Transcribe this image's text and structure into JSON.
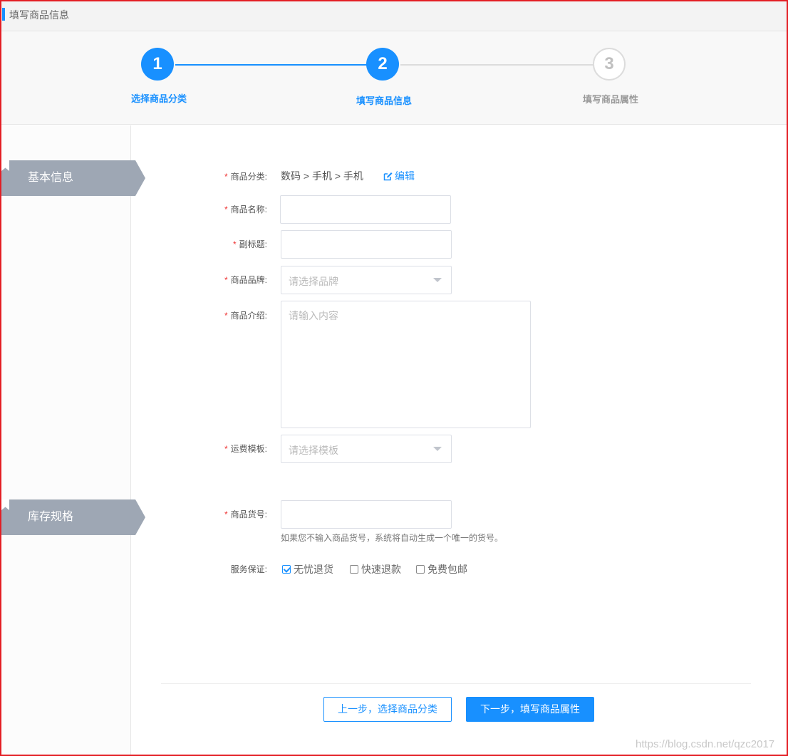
{
  "page": {
    "title": "填写商品信息"
  },
  "colors": {
    "accent": "#1890ff",
    "frame": "#e31e24",
    "required": "#e33333",
    "section_tag": "#9ea7b4"
  },
  "steps": [
    {
      "number": "1",
      "label": "选择商品分类",
      "state": "done"
    },
    {
      "number": "2",
      "label": "填写商品信息",
      "state": "active"
    },
    {
      "number": "3",
      "label": "填写商品属性",
      "state": "pending"
    }
  ],
  "sections": {
    "basic": "基本信息",
    "stock": "库存规格"
  },
  "form": {
    "required_mark": "*",
    "category": {
      "label": "商品分类:",
      "value": "数码 > 手机 > 手机",
      "edit": "编辑"
    },
    "name": {
      "label": "商品名称:",
      "value": ""
    },
    "subtitle": {
      "label": "副标题:",
      "value": ""
    },
    "brand": {
      "label": "商品品牌:",
      "placeholder": "请选择品牌"
    },
    "intro": {
      "label": "商品介绍:",
      "placeholder": "请输入内容"
    },
    "shipping": {
      "label": "运费模板:",
      "placeholder": "请选择模板"
    },
    "sku_no": {
      "label": "商品货号:",
      "value": "",
      "hint": "如果您不输入商品货号，系统将自动生成一个唯一的货号。"
    },
    "service": {
      "label": "服务保证:",
      "options": [
        {
          "label": "无忧退货",
          "checked": true
        },
        {
          "label": "快速退款",
          "checked": false
        },
        {
          "label": "免费包邮",
          "checked": false
        }
      ]
    }
  },
  "buttons": {
    "prev": "上一步，选择商品分类",
    "next": "下一步，填写商品属性"
  },
  "watermark": "https://blog.csdn.net/qzc2017",
  "icons": {
    "section": "bookmark-icon",
    "edit": "edit-icon",
    "caret": "caret-down-icon",
    "check": "checkbox-icon"
  }
}
